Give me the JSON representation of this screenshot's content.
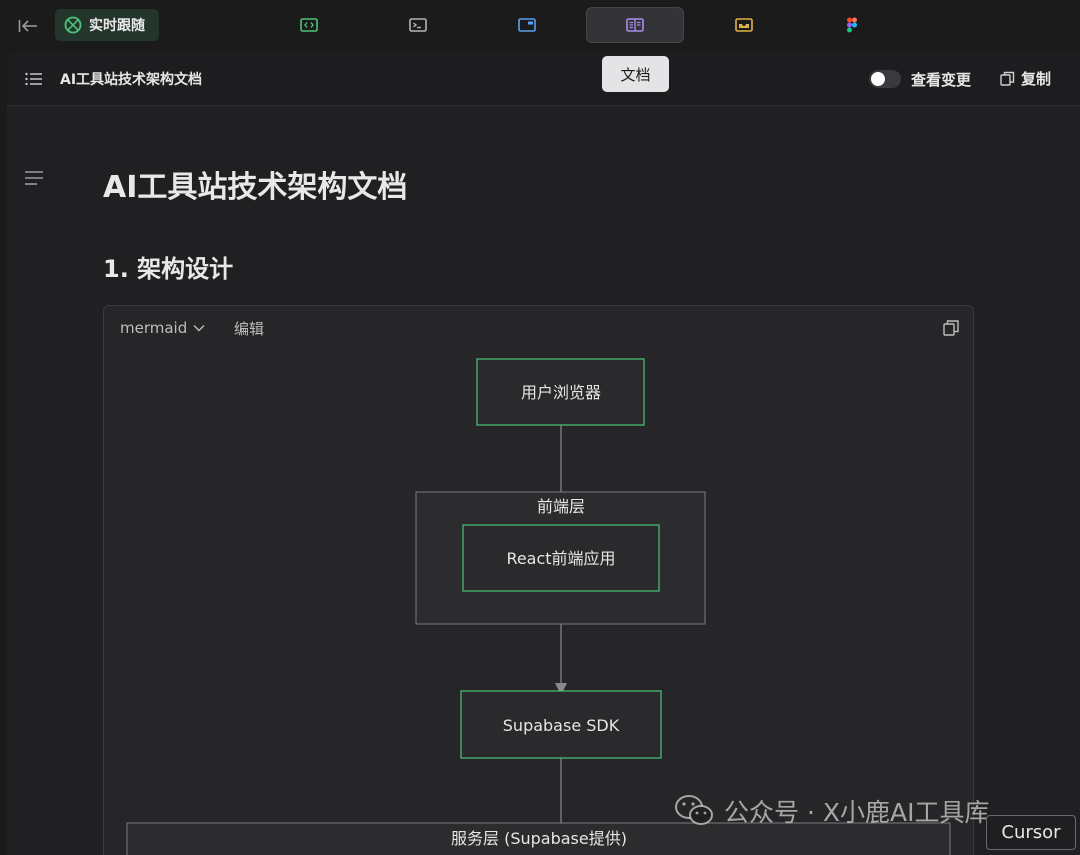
{
  "toolbar": {
    "follow_label": "实时跟随",
    "tooltip": "文档",
    "colors": {
      "green": "#4ec27a",
      "blue": "#5aa0f0",
      "purple": "#a98bf0",
      "amber": "#e0b14a"
    },
    "tabs": [
      {
        "icon": "code-icon"
      },
      {
        "icon": "terminal-icon"
      },
      {
        "icon": "browser-icon"
      },
      {
        "icon": "document-icon"
      },
      {
        "icon": "inbox-icon"
      },
      {
        "icon": "figma-icon"
      }
    ]
  },
  "panel": {
    "title": "AI工具站技术架构文档",
    "view_changes": "查看变更",
    "copy": "复制"
  },
  "doc": {
    "h1": "AI工具站技术架构文档",
    "h2": "1. 架构设计"
  },
  "code_block": {
    "language": "mermaid",
    "edit": "编辑"
  },
  "diagram": {
    "nodes": {
      "browser": "用户浏览器",
      "frontend_group": "前端层",
      "react_app": "React前端应用",
      "sdk": "Supabase SDK",
      "service_group": "服务层 (Supabase提供)"
    }
  },
  "watermark": "公众号 · X小鹿AI工具库",
  "badge": "Cursor"
}
